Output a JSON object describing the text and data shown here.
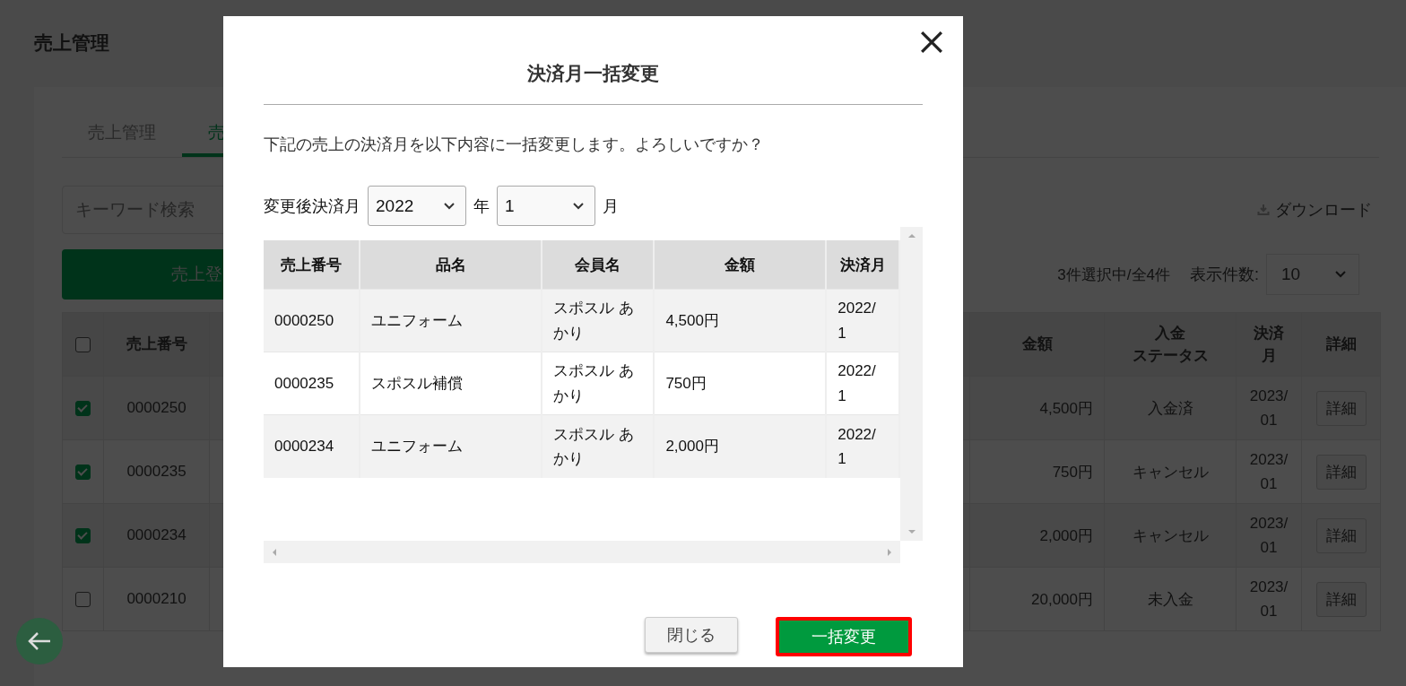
{
  "page": {
    "title": "売上管理"
  },
  "tabs": [
    {
      "label": "売上管理",
      "selected": false
    },
    {
      "label": "売",
      "selected": true
    }
  ],
  "search": {
    "placeholder": "キーワード検索"
  },
  "register_button": "売上登",
  "download": "ダウンロード",
  "selection_count": "3件選択中/全4件",
  "page_size": {
    "label": "表示件数:",
    "value": "10"
  },
  "table": {
    "select_all_checked": false,
    "columns": [
      {
        "lines": [
          "売上番号"
        ]
      },
      {
        "lines": [
          "金額"
        ]
      },
      {
        "lines": [
          "入金",
          "ステータス"
        ]
      },
      {
        "lines": [
          "決済",
          "月"
        ]
      },
      {
        "lines": [
          "詳細"
        ]
      }
    ],
    "rows": [
      {
        "selected": true,
        "number": "0000250",
        "amount": "4,500円",
        "status": "入金済",
        "month": "2023/01",
        "detail": "詳細"
      },
      {
        "selected": true,
        "number": "0000235",
        "amount": "750円",
        "status": "キャンセル",
        "month": "2023/01",
        "detail": "詳細"
      },
      {
        "selected": true,
        "number": "0000234",
        "amount": "2,000円",
        "status": "キャンセル",
        "month": "2023/01",
        "detail": "詳細"
      },
      {
        "selected": false,
        "number": "0000210",
        "amount": "20,000円",
        "status": "未入金",
        "month": "2023/01",
        "detail": "詳細"
      }
    ]
  },
  "dialog": {
    "title": "決済月一括変更",
    "message": "下記の売上の決済月を以下内容に一括変更します。よろしいですか？",
    "month_label": "変更後決済月",
    "year_value": "2022",
    "year_unit": "年",
    "month_value": "1",
    "month_unit": "月",
    "columns": [
      "売上番号",
      "品名",
      "会員名",
      "金額",
      "決済月"
    ],
    "rows": [
      {
        "number": "0000250",
        "item": "ユニフォーム",
        "member": "スポスル あかり",
        "amount": "4,500円",
        "month": "2022/1"
      },
      {
        "number": "0000235",
        "item": "スポスル補償",
        "member": "スポスル あかり",
        "amount": "750円",
        "month": "2022/1"
      },
      {
        "number": "0000234",
        "item": "ユニフォーム",
        "member": "スポスル あかり",
        "amount": "2,000円",
        "month": "2022/1"
      }
    ],
    "close_button": "閉じる",
    "confirm_button": {
      "label": "一括変更",
      "highlighted": true
    }
  }
}
